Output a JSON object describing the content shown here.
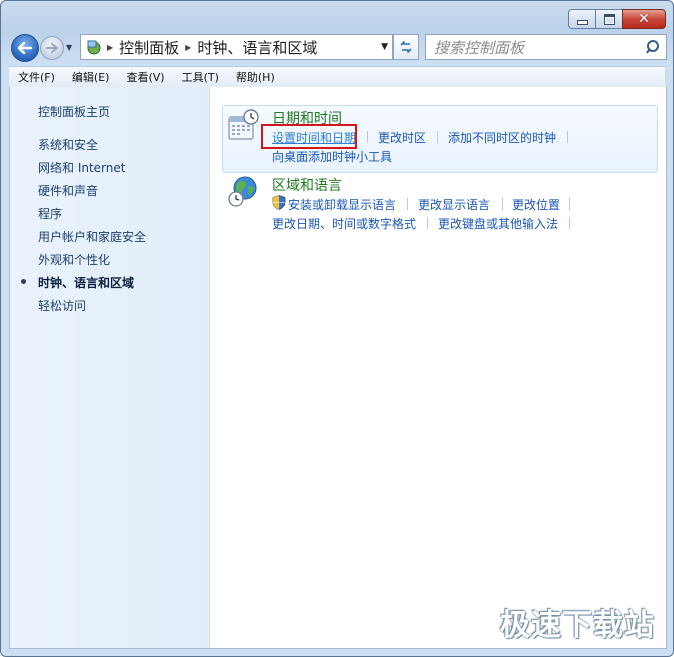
{
  "address_bar": {
    "segments": [
      "控制面板",
      "时钟、语言和区域"
    ]
  },
  "search": {
    "placeholder": "搜索控制面板"
  },
  "menu": {
    "items": [
      "文件(F)",
      "编辑(E)",
      "查看(V)",
      "工具(T)",
      "帮助(H)"
    ]
  },
  "sidebar": {
    "home": "控制面板主页",
    "items": [
      "系统和安全",
      "网络和 Internet",
      "硬件和声音",
      "程序",
      "用户帐户和家庭安全",
      "外观和个性化",
      "时钟、语言和区域",
      "轻松访问"
    ],
    "active_index": 6
  },
  "categories": [
    {
      "title": "日期和时间",
      "icon": "calendar-clock-icon",
      "tasks": [
        "设置时间和日期",
        "更改时区",
        "添加不同时区的时钟",
        "向桌面添加时钟小工具"
      ]
    },
    {
      "title": "区域和语言",
      "icon": "globe-clock-icon",
      "tasks": [
        "安装或卸载显示语言",
        "更改显示语言",
        "更改位置",
        "更改日期、时间或数字格式",
        "更改键盘或其他输入法"
      ]
    }
  ],
  "watermark": "极速下载站",
  "colors": {
    "category_title": "#1f7a1f",
    "link": "#1a56b5",
    "highlight_border": "#d2161b"
  }
}
